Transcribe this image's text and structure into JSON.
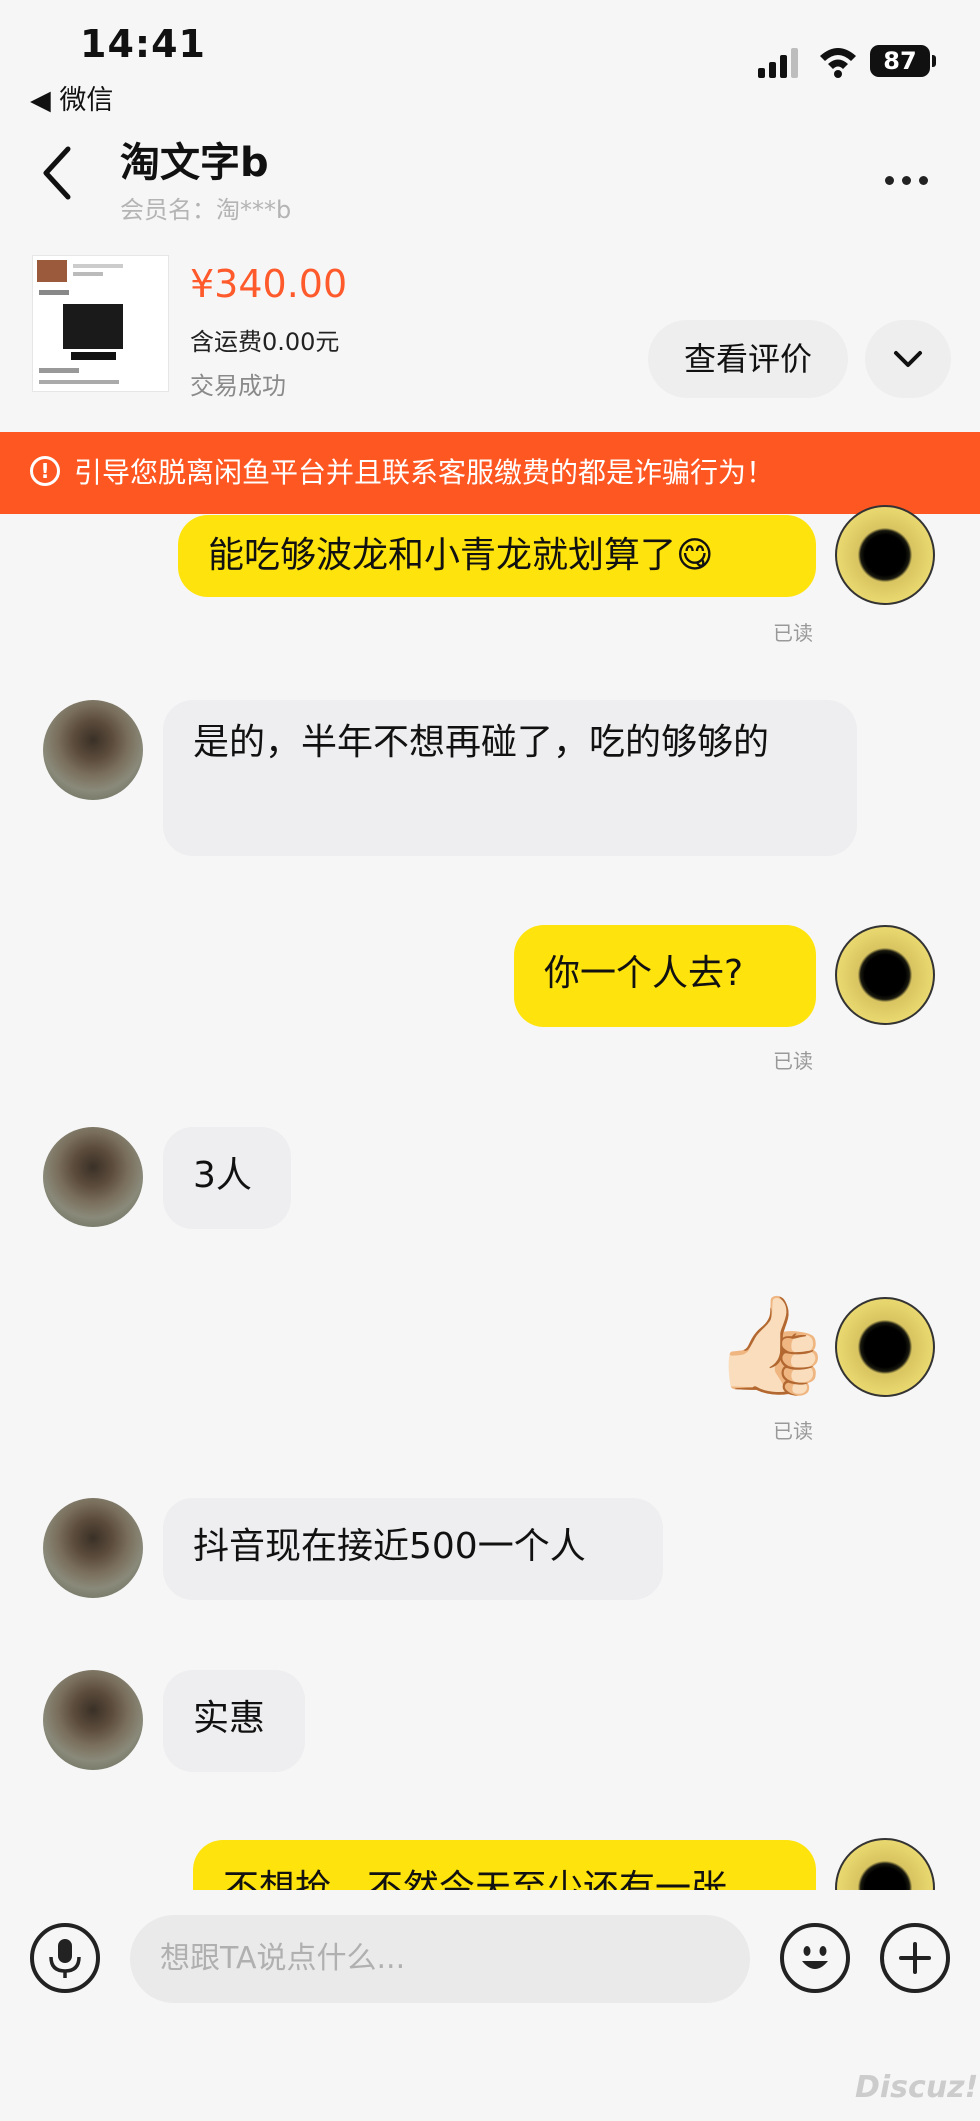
{
  "status_bar": {
    "time": "14:41",
    "back_app": "◀ 微信",
    "battery": "87"
  },
  "header": {
    "title": "淘文字b",
    "subtitle": "会员名：淘***b"
  },
  "product": {
    "price": "¥340.00",
    "shipping": "含运费0.00元",
    "status": "交易成功",
    "review_button": "查看评价"
  },
  "warning": {
    "text": "引导您脱离闲鱼平台并且联系客服缴费的都是诈骗行为！"
  },
  "messages": [
    {
      "side": "mine",
      "text": "能吃够波龙和小青龙就划算了😋",
      "read": "已读"
    },
    {
      "side": "theirs",
      "text": "是的，半年不想再碰了，吃的够够的"
    },
    {
      "side": "mine",
      "text": "你一个人去?",
      "read": "已读"
    },
    {
      "side": "theirs",
      "text": "3人"
    },
    {
      "side": "mine",
      "text": "👍🏻",
      "read": "已读"
    },
    {
      "side": "theirs",
      "text": "抖音现在接近500一个人"
    },
    {
      "side": "theirs",
      "text": "实惠"
    },
    {
      "side": "mine",
      "text": "不想抢，不然今天至少还有一张"
    }
  ],
  "input": {
    "placeholder": "想跟TA说点什么..."
  },
  "watermark": "Discuz!"
}
